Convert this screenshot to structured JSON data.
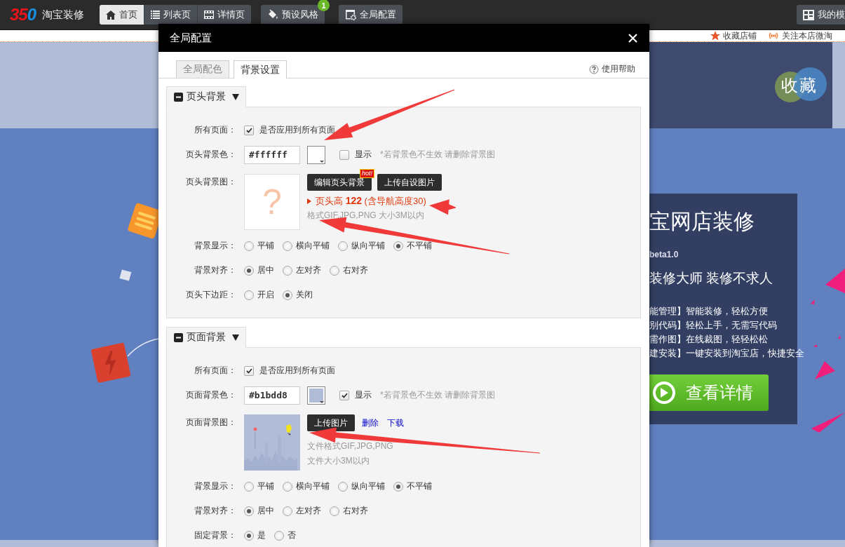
{
  "top_bar": {
    "logo": {
      "mark": "350",
      "name": "淘宝装修"
    },
    "page_tabs": [
      {
        "label": "首页",
        "selected": true
      },
      {
        "label": "列表页",
        "selected": false
      },
      {
        "label": "详情页",
        "selected": false
      }
    ],
    "tools": [
      {
        "label": "预设风格",
        "badge": "1"
      },
      {
        "label": "全局配置"
      }
    ],
    "my_templates": "我的模"
  },
  "store_preview": {
    "links": [
      "收藏店铺",
      "关注本店微淘"
    ],
    "favorite_stamp": "收藏",
    "banner": {
      "title": "宝网店装修",
      "version": "beta1.0",
      "slogan": "装修大师  装修不求人",
      "features": [
        "能管理】智能装修，轻松方便",
        "别代码】轻松上手，无需写代码",
        "需作图】在线裁图，轻轻松松",
        "建安装】一键安装到淘宝店，快捷安全"
      ],
      "button": "查看详情"
    }
  },
  "dialog": {
    "title": "全局配置",
    "tabs": [
      {
        "label": "全局配色",
        "selected": false
      },
      {
        "label": "背景设置",
        "selected": true
      }
    ],
    "help": "使用帮助",
    "sections": [
      {
        "title": "页头背景",
        "expanded": true,
        "rows": [
          {
            "kind": "checkbox",
            "label": "所有页面：",
            "checked": true,
            "text": "是否应用到所有页面"
          },
          {
            "kind": "color",
            "label": "页头背景色：",
            "value": "#ffffff",
            "show": {
              "label": "显示",
              "checked": false
            },
            "hint": "*若背景色不生效 请删除背景图"
          },
          {
            "label": "页头背景图：",
            "preview": {
              "kind": "empty",
              "symbol": "?"
            },
            "buttons": [
              {
                "label": "编辑页头背景",
                "badge": "hot!"
              },
              {
                "label": "上传自设图片"
              }
            ],
            "notes": [
              {
                "kind": "highlight",
                "text": "页头高 **122** (含导航高度30)"
              },
              {
                "kind": "plain",
                "text": "格式GIF,JPG,PNG 大小3M以内"
              }
            ]
          },
          {
            "kind": "radio",
            "label": "背景显示：",
            "options": [
              {
                "label": "平铺",
                "selected": false
              },
              {
                "label": "横向平铺",
                "selected": false
              },
              {
                "label": "纵向平铺",
                "selected": false
              },
              {
                "label": "不平铺",
                "selected": true
              }
            ]
          },
          {
            "kind": "radio",
            "label": "背景对齐：",
            "options": [
              {
                "label": "居中",
                "selected": true
              },
              {
                "label": "左对齐",
                "selected": false
              },
              {
                "label": "右对齐",
                "selected": false
              }
            ]
          },
          {
            "kind": "radio",
            "label": "页头下边距：",
            "options": [
              {
                "label": "开启",
                "selected": false
              },
              {
                "label": "关闭",
                "selected": true
              }
            ]
          }
        ]
      },
      {
        "title": "页面背景",
        "expanded": true,
        "rows": [
          {
            "kind": "checkbox",
            "label": "所有页面：",
            "checked": true,
            "text": "是否应用到所有页面"
          },
          {
            "kind": "color",
            "label": "页面背景色：",
            "value": "#b1bdd8",
            "show": {
              "label": "显示",
              "checked": true
            },
            "hint": "*若背景色不生效 请删除背景图"
          },
          {
            "label": "页面背景图：",
            "preview": {
              "kind": "picture"
            },
            "buttons": [
              {
                "label": "上传图片"
              }
            ],
            "links": [
              "删除",
              "下载"
            ],
            "notes": [
              {
                "kind": "plain",
                "text": "文件格式GIF,JPG,PNG"
              },
              {
                "kind": "plain",
                "text": "文件大小3M以内"
              }
            ]
          },
          {
            "kind": "radio",
            "label": "背景显示：",
            "options": [
              {
                "label": "平铺",
                "selected": false
              },
              {
                "label": "横向平铺",
                "selected": false
              },
              {
                "label": "纵向平铺",
                "selected": false
              },
              {
                "label": "不平铺",
                "selected": true
              }
            ]
          },
          {
            "kind": "radio",
            "label": "背景对齐：",
            "options": [
              {
                "label": "居中",
                "selected": true
              },
              {
                "label": "左对齐",
                "selected": false
              },
              {
                "label": "右对齐",
                "selected": false
              }
            ]
          },
          {
            "kind": "radio",
            "label": "固定背景：",
            "options": [
              {
                "label": "是",
                "selected": true
              },
              {
                "label": "否",
                "selected": false
              }
            ]
          }
        ]
      }
    ]
  }
}
